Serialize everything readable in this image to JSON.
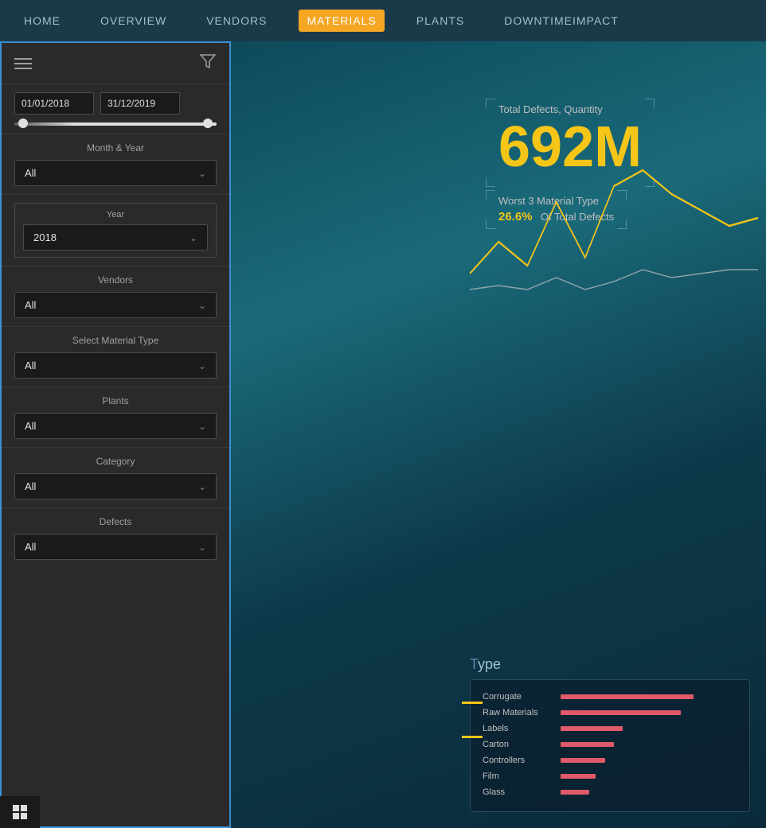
{
  "navbar": {
    "items": [
      {
        "label": "Home",
        "active": false
      },
      {
        "label": "Overview",
        "active": false
      },
      {
        "label": "Vendors",
        "active": false
      },
      {
        "label": "Materials",
        "active": true
      },
      {
        "label": "Plants",
        "active": false
      },
      {
        "label": "DowntimeImpact",
        "active": false
      }
    ]
  },
  "sidebar": {
    "dateStart": "01/01/2018",
    "dateEnd": "31/12/2019",
    "filters": [
      {
        "label": "Month & Year",
        "value": "All",
        "id": "month-year"
      },
      {
        "label": "Year",
        "boxLabel": "Year",
        "value": "2018",
        "id": "year"
      },
      {
        "label": "Vendors",
        "value": "All",
        "id": "vendors"
      },
      {
        "label": "Select Material Type",
        "value": "All",
        "id": "material-type"
      },
      {
        "label": "Plants",
        "value": "All",
        "id": "plants"
      },
      {
        "label": "Category",
        "value": "All",
        "id": "category"
      },
      {
        "label": "Defects",
        "value": "All",
        "id": "defects"
      }
    ]
  },
  "main": {
    "kpi": {
      "totalLabel": "Total Defects, Quantity",
      "totalValue": "692M",
      "worstLabel": "Worst 3 Material Type",
      "worstPercent": "26.6%",
      "worstSuffix": "Of Total Defects"
    },
    "barChart": {
      "titlePrefix": "",
      "titleHighlight": "ype",
      "items": [
        {
          "name": "Corrugate",
          "pct": 75
        },
        {
          "name": "Raw Materials",
          "pct": 68
        },
        {
          "name": "Labels",
          "pct": 35
        },
        {
          "name": "Carton",
          "pct": 30
        },
        {
          "name": "Controllers",
          "pct": 25
        },
        {
          "name": "Film",
          "pct": 20
        },
        {
          "name": "Glass",
          "pct": 16
        }
      ]
    }
  },
  "icons": {
    "hamburger": "☰",
    "filter": "⛶",
    "chevronDown": "∨",
    "windows": "⊞"
  }
}
